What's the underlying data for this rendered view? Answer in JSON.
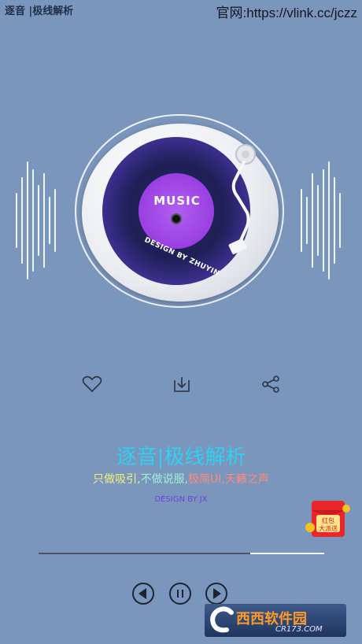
{
  "header": {
    "app_title": "逐音 |极线解析",
    "site_url": "官网:https://vlink.cc/jczz"
  },
  "disc": {
    "music_label": "MUSIC",
    "design_label": "DESIGN BY ZHUYIN"
  },
  "controls": {
    "icons": [
      "heart-icon",
      "download-icon",
      "share-icon"
    ]
  },
  "content": {
    "title": "逐音|极线解析",
    "slogan_part1": "只做吸引,",
    "slogan_part2": "不做说服,",
    "slogan_part3": "极简UI,天籁之声",
    "designer": "DESIGN BY JX"
  },
  "player": {
    "progress": 0.74
  },
  "promo": {
    "red_packet_text_1": "红包",
    "red_packet_text_2": "大派送"
  },
  "watermark": {
    "main": "西西软件园",
    "site": "CR173.COM"
  },
  "colors": {
    "background": "#7b96bd",
    "title": "#2fd0f2",
    "designer": "#6f3fe0"
  }
}
